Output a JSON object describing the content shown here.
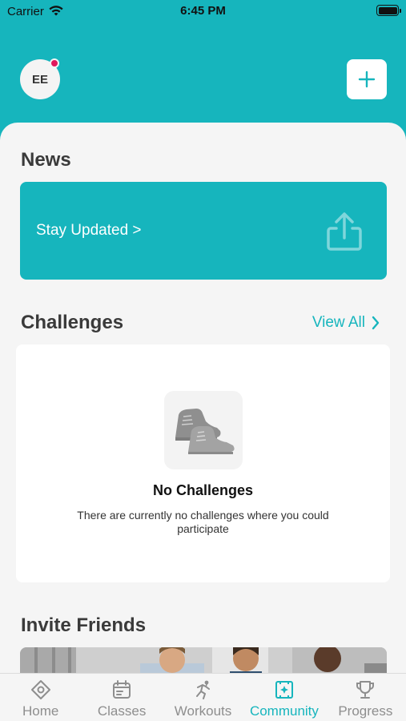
{
  "status_bar": {
    "carrier": "Carrier",
    "time": "6:45 PM"
  },
  "header": {
    "avatar_initials": "EE"
  },
  "news": {
    "title": "News",
    "card_label": "Stay Updated >"
  },
  "challenges": {
    "title": "Challenges",
    "view_all": "View All",
    "empty_title": "No Challenges",
    "empty_description": "There are currently no challenges where you could participate"
  },
  "invite": {
    "title": "Invite Friends"
  },
  "tabs": [
    {
      "label": "Home",
      "icon": "home-icon"
    },
    {
      "label": "Classes",
      "icon": "calendar-icon"
    },
    {
      "label": "Workouts",
      "icon": "running-icon"
    },
    {
      "label": "Community",
      "icon": "community-icon",
      "active": true
    },
    {
      "label": "Progress",
      "icon": "trophy-icon"
    }
  ],
  "colors": {
    "accent": "#16b5bd",
    "notification": "#e0195c"
  }
}
